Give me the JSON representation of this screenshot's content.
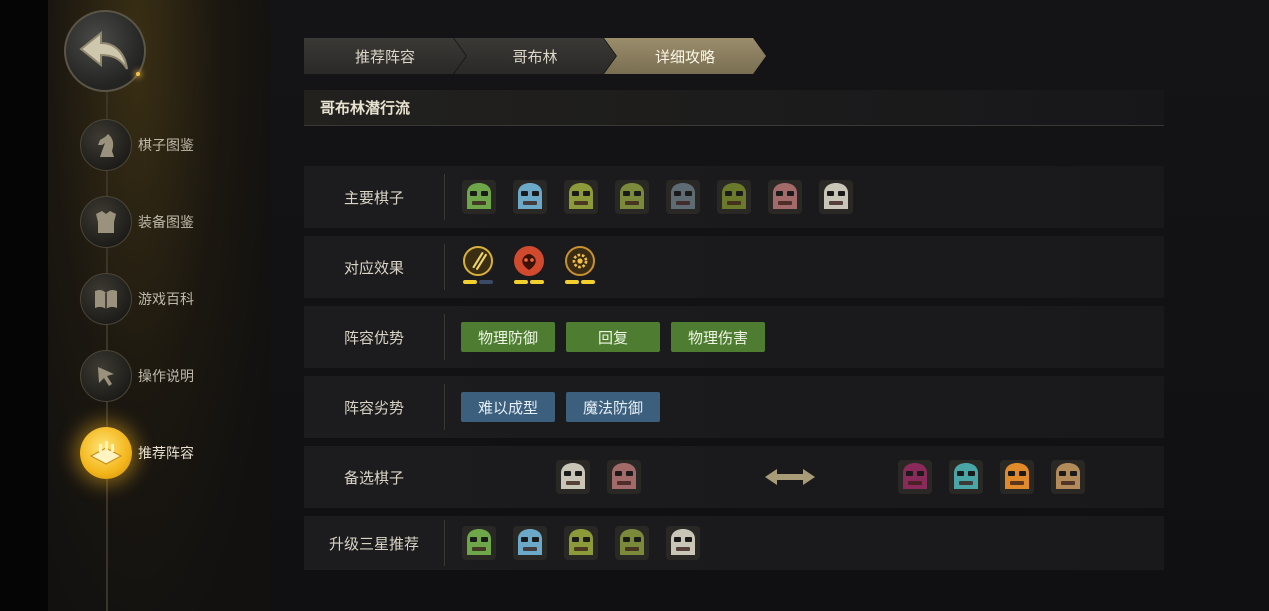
{
  "sidebar": {
    "back_icon": "back-arrow-icon",
    "items": [
      {
        "label": "棋子图鉴",
        "icon": "knight-icon",
        "active": false
      },
      {
        "label": "装备图鉴",
        "icon": "armor-icon",
        "active": false
      },
      {
        "label": "游戏百科",
        "icon": "book-icon",
        "active": false
      },
      {
        "label": "操作说明",
        "icon": "pointer-icon",
        "active": false
      },
      {
        "label": "推荐阵容",
        "icon": "board-icon",
        "active": true
      }
    ]
  },
  "breadcrumb": [
    "推荐阵容",
    "哥布林",
    "详细攻略"
  ],
  "title": "哥布林潜行流",
  "rows": {
    "main_pieces": {
      "label": "主要棋子",
      "pieces": [
        {
          "name": "piece-1",
          "color": "#6ea64a"
        },
        {
          "name": "piece-2",
          "color": "#6ca9c8"
        },
        {
          "name": "piece-3",
          "color": "#8c9a3a"
        },
        {
          "name": "piece-4",
          "color": "#7a8a3a"
        },
        {
          "name": "piece-5",
          "color": "#5f6b72"
        },
        {
          "name": "piece-6",
          "color": "#6a7a2a"
        },
        {
          "name": "piece-7",
          "color": "#a36a6a"
        },
        {
          "name": "piece-8",
          "color": "#c9c6b8"
        }
      ]
    },
    "effects": {
      "label": "对应效果",
      "items": [
        {
          "icon": "daggers-icon",
          "color": "#d8b03a",
          "pips": [
            "#f2cf2c",
            "#3a4a66"
          ]
        },
        {
          "icon": "demon-icon",
          "color": "#d24a2e",
          "pips": [
            "#f2cf2c",
            "#f2cf2c"
          ]
        },
        {
          "icon": "gear-icon",
          "color": "#c9902e",
          "pips": [
            "#f2cf2c",
            "#f2cf2c"
          ]
        }
      ]
    },
    "strengths": {
      "label": "阵容优势",
      "tags": [
        "物理防御",
        "回复",
        "物理伤害"
      ]
    },
    "weaknesses": {
      "label": "阵容劣势",
      "tags": [
        "难以成型",
        "魔法防御"
      ]
    },
    "alternatives": {
      "label": "备选棋子",
      "left": [
        {
          "name": "alt-piece-1",
          "color": "#c9c6b8"
        },
        {
          "name": "alt-piece-2",
          "color": "#a36a6a"
        }
      ],
      "swap_icon": "swap-arrow-icon",
      "right": [
        {
          "name": "alt-piece-3",
          "color": "#8a2a5a"
        },
        {
          "name": "alt-piece-4",
          "color": "#4aa6a6"
        },
        {
          "name": "alt-piece-5",
          "color": "#e08a2a"
        },
        {
          "name": "alt-piece-6",
          "color": "#b38a5a"
        }
      ]
    },
    "upgrade": {
      "label": "升级三星推荐",
      "pieces": [
        {
          "name": "upgrade-piece-1",
          "color": "#6ea64a"
        },
        {
          "name": "upgrade-piece-2",
          "color": "#6ca9c8"
        },
        {
          "name": "upgrade-piece-3",
          "color": "#8c9a3a"
        },
        {
          "name": "upgrade-piece-4",
          "color": "#7a8a3a"
        },
        {
          "name": "upgrade-piece-5",
          "color": "#c9c6b8"
        }
      ]
    }
  }
}
